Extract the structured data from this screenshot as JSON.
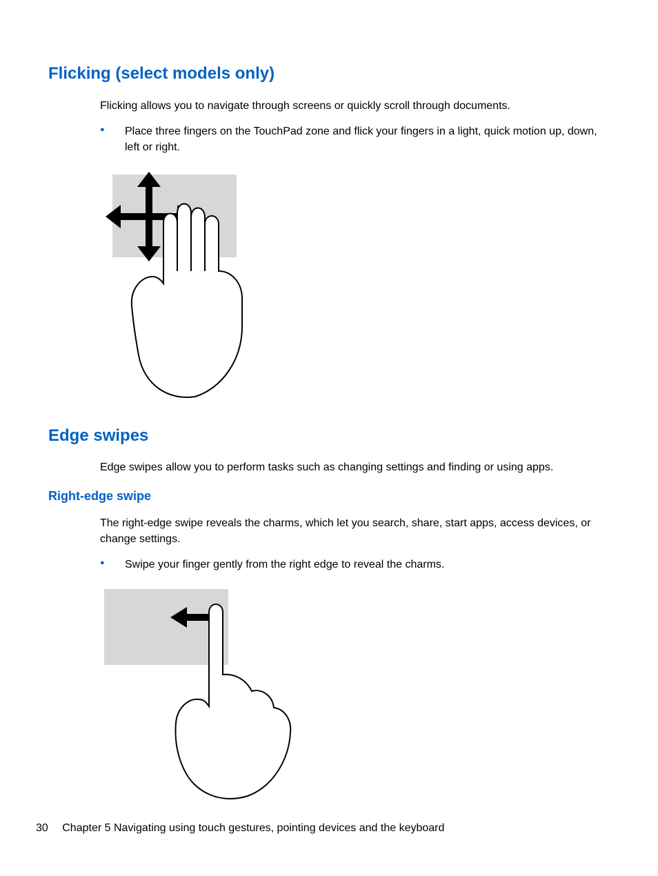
{
  "section1": {
    "heading": "Flicking (select models only)",
    "intro": "Flicking allows you to navigate through screens or quickly scroll through documents.",
    "bullet": "Place three fingers on the TouchPad zone and flick your fingers in a light, quick motion up, down, left or right."
  },
  "section2": {
    "heading": "Edge swipes",
    "intro": "Edge swipes allow you to perform tasks such as changing settings and finding or using apps."
  },
  "section3": {
    "heading": "Right-edge swipe",
    "intro": "The right-edge swipe reveals the charms, which let you search, share, start apps, access devices, or change settings.",
    "bullet": "Swipe your finger gently from the right edge to reveal the charms."
  },
  "footer": {
    "page_number": "30",
    "chapter": "Chapter 5   Navigating using touch gestures, pointing devices and the keyboard"
  }
}
